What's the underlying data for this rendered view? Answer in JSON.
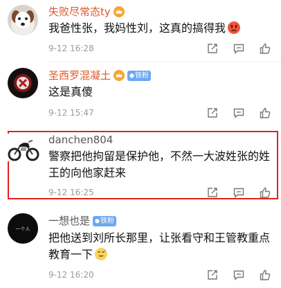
{
  "comments": [
    {
      "username": "失败尽常态ty",
      "username_color": "#e0582b",
      "badge": "crown",
      "text": "我爸性张，我妈性刘，这真的搞得我",
      "emoji": "angry-face",
      "time": "9-12 16:28"
    },
    {
      "username": "圣西罗混凝土",
      "username_color": "#e0582b",
      "badge": "crown",
      "fan_badge": "铁粉",
      "text": "这是真傻",
      "time": "9-12 15:47"
    },
    {
      "username": "danchen804",
      "username_color": "#555555",
      "text": "警察把他拘留是保护他，不然一大波姓张的姓王的向他家赶来",
      "time": "9-12 16:25",
      "highlighted": true
    },
    {
      "username": "一想也是",
      "username_color": "#555555",
      "fan_badge": "铁粉",
      "avatar_text": "一个人",
      "text": "把他送到刘所长那里，让张看守和王管教重点教育一下",
      "emoji": "sweat-smile-face",
      "time": "9-12 16:20"
    }
  ],
  "colors": {
    "highlight_border": "#e02020",
    "fan_badge_bg": "#6aa8f2",
    "time": "#999999"
  },
  "icons": [
    "share-icon",
    "reply-icon",
    "like-icon",
    "crown-badge-icon",
    "fan-badge-icon"
  ]
}
